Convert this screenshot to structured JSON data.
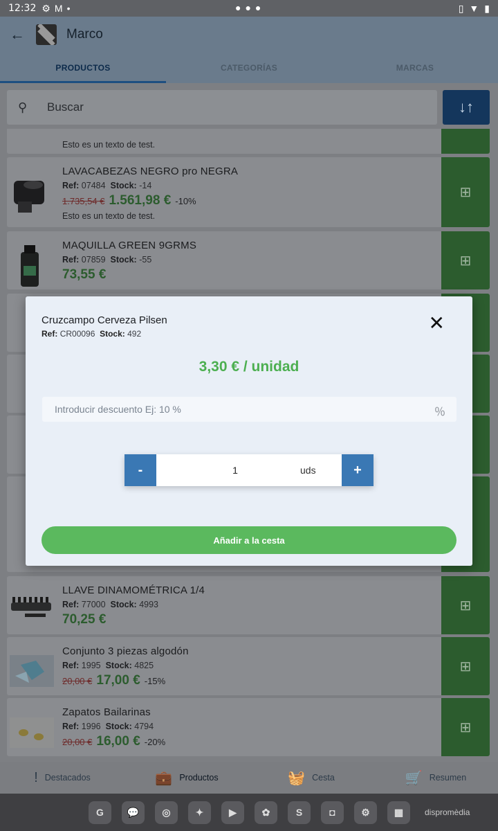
{
  "status_bar": {
    "time": "12:32",
    "left_icons": [
      "settings-icon",
      "gmail-icon",
      "dot-icon"
    ],
    "center": "●●●",
    "right_icons": [
      "vibrate-icon",
      "wifi-icon",
      "battery-icon"
    ]
  },
  "app_bar": {
    "back_icon": "←",
    "title": "Marco"
  },
  "tabs": [
    {
      "label": "PRODUCTOS",
      "active": true
    },
    {
      "label": "CATEGORÍAS",
      "active": false
    },
    {
      "label": "MARCAS",
      "active": false
    }
  ],
  "search": {
    "icon": "🔍",
    "placeholder": "Buscar",
    "sort_icon": "↓↑"
  },
  "products": [
    {
      "name": "",
      "ref": "",
      "stock": "",
      "old_price": "",
      "price": "",
      "discount": "",
      "desc": "Esto es un texto de test."
    },
    {
      "name": "LAVACABEZAS NEGRO pro NEGRA",
      "ref": "07484",
      "stock": "-14",
      "old_price": "1.735,54 €",
      "price": "1.561,98 €",
      "discount": "-10%",
      "desc": "Esto es un texto de test."
    },
    {
      "name": "MAQUILLA GREEN 9GRMS",
      "ref": "07859",
      "stock": "-55",
      "old_price": "",
      "price": "73,55 €",
      "discount": "",
      "desc": ""
    },
    {
      "name": "LLAVE DINAMOMÉTRICA 1/4",
      "ref": "77000",
      "stock": "4993",
      "old_price": "",
      "price": "70,25 €",
      "discount": "",
      "desc": ""
    },
    {
      "name": "Conjunto 3 piezas algodón",
      "ref": "1995",
      "stock": "4825",
      "old_price": "20,00 €",
      "price": "17,00 €",
      "discount": "-15%",
      "desc": ""
    },
    {
      "name": "Zapatos Bailarinas",
      "ref": "1996",
      "stock": "4794",
      "old_price": "20,00 €",
      "price": "16,00 €",
      "discount": "-20%",
      "desc": ""
    }
  ],
  "labels": {
    "ref": "Ref:",
    "stock": "Stock:"
  },
  "modal": {
    "title": "Cruzcampo Cerveza Pilsen",
    "ref_label": "Ref:",
    "ref": "CR00096",
    "stock_label": "Stock:",
    "stock": "492",
    "close_icon": "✕",
    "unit_price": "3,30 € / unidad",
    "discount_placeholder": "Introducir descuento Ej: 10 %",
    "discount_icon": "％",
    "minus": "-",
    "quantity": "1",
    "unit": "uds",
    "plus": "+",
    "add_button": "Añadir a la cesta"
  },
  "bottom_nav": [
    {
      "label": "Destacados",
      "icon": "!",
      "active": false
    },
    {
      "label": "Productos",
      "icon": "💼",
      "active": true
    },
    {
      "label": "Cesta",
      "icon": "🧺",
      "active": false
    },
    {
      "label": "Resumen",
      "icon": "🛒",
      "active": false
    }
  ],
  "dock": {
    "apps": [
      "G",
      "💬",
      "◎",
      "✦",
      "▶",
      "✿",
      "S",
      "◘",
      "⚙",
      "▦"
    ],
    "brand": "dispromèdia"
  }
}
